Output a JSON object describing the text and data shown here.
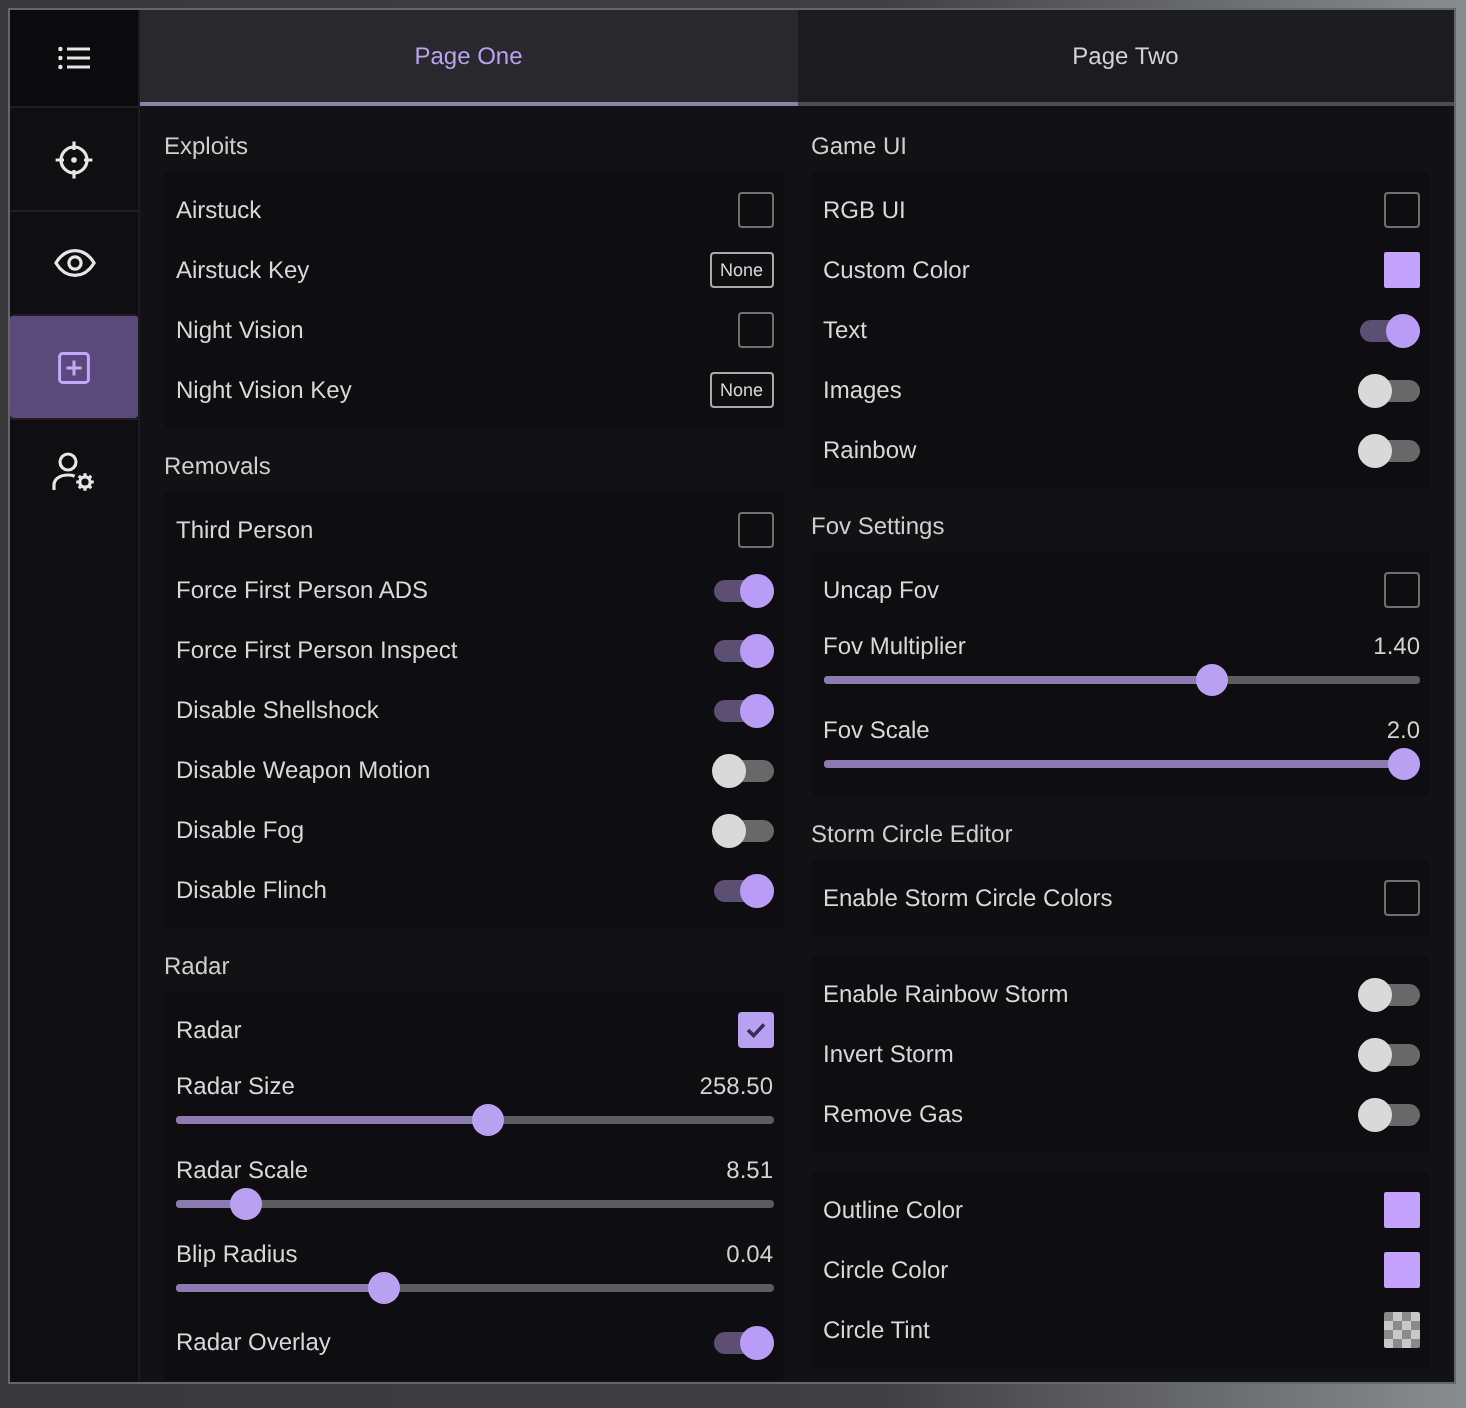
{
  "sidebar": {
    "items": [
      {
        "selected": false
      },
      {
        "selected": false
      },
      {
        "selected": true
      },
      {
        "selected": false
      }
    ]
  },
  "tabs": [
    {
      "label": "Page One",
      "selected": true
    },
    {
      "label": "Page Two",
      "selected": false
    }
  ],
  "columns": [
    {
      "sections": [
        {
          "title": "Exploits",
          "groups": [
            [
              {
                "kind": "checkbox",
                "label": "Airstuck",
                "checked": false
              },
              {
                "kind": "key",
                "label": "Airstuck Key",
                "value": "None"
              },
              {
                "kind": "checkbox",
                "label": "Night Vision",
                "checked": false
              },
              {
                "kind": "key",
                "label": "Night Vision Key",
                "value": "None"
              }
            ]
          ]
        },
        {
          "title": "Removals",
          "groups": [
            [
              {
                "kind": "checkbox",
                "label": "Third Person",
                "checked": false
              },
              {
                "kind": "toggle",
                "label": "Force First Person ADS",
                "on": true
              },
              {
                "kind": "toggle",
                "label": "Force First Person Inspect",
                "on": true
              },
              {
                "kind": "toggle",
                "label": "Disable Shellshock",
                "on": true
              },
              {
                "kind": "toggle",
                "label": "Disable Weapon Motion",
                "on": false
              },
              {
                "kind": "toggle",
                "label": "Disable Fog",
                "on": false
              },
              {
                "kind": "toggle",
                "label": "Disable Flinch",
                "on": true
              }
            ]
          ]
        },
        {
          "title": "Radar",
          "groups": [
            [
              {
                "kind": "checkbox",
                "label": "Radar",
                "checked": true
              },
              {
                "kind": "slider",
                "label": "Radar Size",
                "reading": "258.50",
                "level": 0.525
              },
              {
                "kind": "slider",
                "label": "Radar Scale",
                "reading": "8.51",
                "level": 0.097
              },
              {
                "kind": "slider",
                "label": "Blip Radius",
                "reading": "0.04",
                "level": 0.34
              },
              {
                "kind": "toggle",
                "label": "Radar Overlay",
                "on": true
              }
            ]
          ]
        }
      ]
    },
    {
      "sections": [
        {
          "title": "Game UI",
          "groups": [
            [
              {
                "kind": "checkbox",
                "label": "RGB UI",
                "checked": false
              },
              {
                "kind": "color",
                "label": "Custom Color",
                "color": "#c3a3fb",
                "transparent": false
              },
              {
                "kind": "toggle",
                "label": "Text",
                "on": true
              },
              {
                "kind": "toggle",
                "label": "Images",
                "on": false
              },
              {
                "kind": "toggle",
                "label": "Rainbow",
                "on": false
              }
            ]
          ]
        },
        {
          "title": "Fov Settings",
          "groups": [
            [
              {
                "kind": "checkbox",
                "label": "Uncap Fov",
                "checked": false
              },
              {
                "kind": "slider",
                "label": "Fov Multiplier",
                "reading": "1.40",
                "level": 0.66
              },
              {
                "kind": "slider",
                "label": "Fov Scale",
                "reading": "2.0",
                "level": 1
              }
            ]
          ]
        },
        {
          "title": "Storm Circle Editor",
          "groups": [
            [
              {
                "kind": "checkbox",
                "label": "Enable Storm Circle Colors",
                "checked": false
              }
            ],
            [
              {
                "kind": "toggle",
                "label": "Enable Rainbow Storm",
                "on": false
              },
              {
                "kind": "toggle",
                "label": "Invert Storm",
                "on": false
              },
              {
                "kind": "toggle",
                "label": "Remove Gas",
                "on": false
              }
            ],
            [
              {
                "kind": "color",
                "label": "Outline Color",
                "color": "#c3a3fb",
                "transparent": false
              },
              {
                "kind": "color",
                "label": "Circle Color",
                "color": "#c3a3fb",
                "transparent": false
              },
              {
                "kind": "color",
                "label": "Circle Tint",
                "transparent": true
              }
            ]
          ]
        }
      ]
    }
  ]
}
